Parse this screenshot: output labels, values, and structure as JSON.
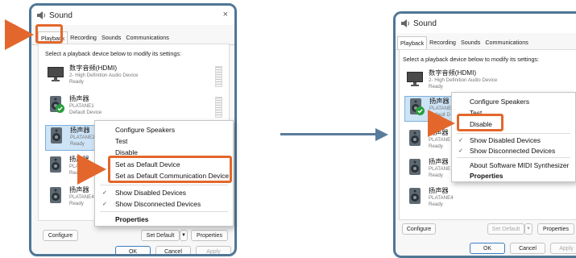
{
  "colors": {
    "highlight": "#e3672c",
    "frame": "#4f7696",
    "selection": "#cde3f6",
    "default_check": "#2a9d3c"
  },
  "dialog": {
    "title": "Sound",
    "close_glyph": "×",
    "tabs": [
      "Playback",
      "Recording",
      "Sounds",
      "Communications"
    ],
    "instruction": "Select a playback device below to modify its settings:",
    "devices": [
      {
        "name": "数字音频(HDMI)",
        "line2": "2- High Definition Audio Device",
        "line3": "Ready",
        "icon": "monitor-icon"
      },
      {
        "name": "扬声器",
        "line2": "PLATANE1",
        "line3": "Default Device",
        "icon": "speaker-icon",
        "default": true
      },
      {
        "name": "扬声器",
        "line2": "PLATANE2",
        "line3": "Ready",
        "icon": "speaker-icon"
      },
      {
        "name": "扬声器",
        "line2": "PLATANE3",
        "line3": "Ready",
        "icon": "speaker-icon"
      },
      {
        "name": "扬声器",
        "line2": "PLATANE4",
        "line3": "Ready",
        "icon": "speaker-icon"
      }
    ],
    "buttons": {
      "configure": "Configure",
      "set_default": "Set Default",
      "properties": "Properties",
      "ok": "OK",
      "cancel": "Cancel",
      "apply": "Apply"
    }
  },
  "left_menu": {
    "items": [
      "Configure Speakers",
      "Test",
      "Disable",
      "Set as Default Device",
      "Set as Default Communication Device",
      "Show Disabled Devices",
      "Show Disconnected Devices",
      "Properties"
    ],
    "checked": [
      "Show Disabled Devices",
      "Show Disconnected Devices"
    ]
  },
  "right_menu": {
    "items": [
      "Configure Speakers",
      "Test",
      "Disable",
      "Show Disabled Devices",
      "Show Disconnected Devices",
      "About Software MIDI Synthesizer",
      "Properties"
    ],
    "checked": [
      "Show Disabled Devices",
      "Show Disconnected Devices"
    ]
  },
  "right_devices_visible": [
    {
      "name": "数字音频(HDMI)",
      "line2": "2- High Definition Audio Device",
      "line3": "Ready"
    },
    {
      "name": "扬声器",
      "line2": "PLATANE",
      "line3": "Default D"
    },
    {
      "name": "扬声器",
      "line2": "PLATANE",
      "line3": "Ready"
    },
    {
      "name": "扬声器",
      "line2": "PLATANE",
      "line3": "Ready"
    },
    {
      "name": "扬声器",
      "line2": "PLATANE4",
      "line3": "Ready"
    }
  ]
}
